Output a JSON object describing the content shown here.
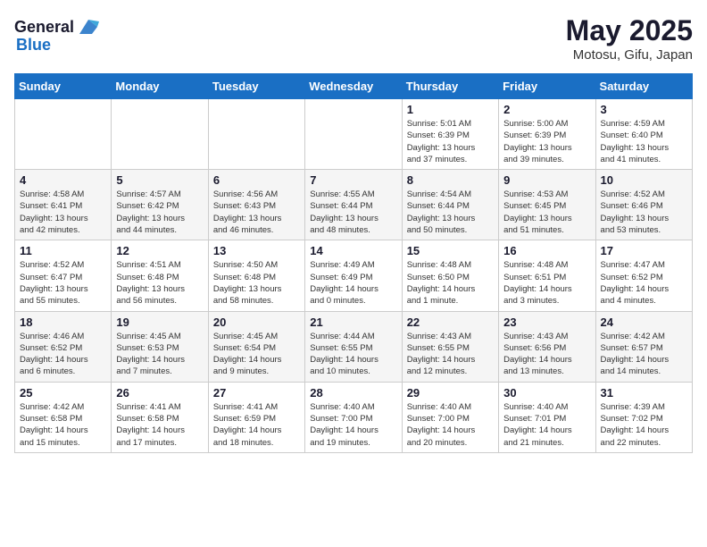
{
  "header": {
    "logo_general": "General",
    "logo_blue": "Blue",
    "month_year": "May 2025",
    "location": "Motosu, Gifu, Japan"
  },
  "weekdays": [
    "Sunday",
    "Monday",
    "Tuesday",
    "Wednesday",
    "Thursday",
    "Friday",
    "Saturday"
  ],
  "weeks": [
    [
      {
        "day": "",
        "info": ""
      },
      {
        "day": "",
        "info": ""
      },
      {
        "day": "",
        "info": ""
      },
      {
        "day": "",
        "info": ""
      },
      {
        "day": "1",
        "info": "Sunrise: 5:01 AM\nSunset: 6:39 PM\nDaylight: 13 hours\nand 37 minutes."
      },
      {
        "day": "2",
        "info": "Sunrise: 5:00 AM\nSunset: 6:39 PM\nDaylight: 13 hours\nand 39 minutes."
      },
      {
        "day": "3",
        "info": "Sunrise: 4:59 AM\nSunset: 6:40 PM\nDaylight: 13 hours\nand 41 minutes."
      }
    ],
    [
      {
        "day": "4",
        "info": "Sunrise: 4:58 AM\nSunset: 6:41 PM\nDaylight: 13 hours\nand 42 minutes."
      },
      {
        "day": "5",
        "info": "Sunrise: 4:57 AM\nSunset: 6:42 PM\nDaylight: 13 hours\nand 44 minutes."
      },
      {
        "day": "6",
        "info": "Sunrise: 4:56 AM\nSunset: 6:43 PM\nDaylight: 13 hours\nand 46 minutes."
      },
      {
        "day": "7",
        "info": "Sunrise: 4:55 AM\nSunset: 6:44 PM\nDaylight: 13 hours\nand 48 minutes."
      },
      {
        "day": "8",
        "info": "Sunrise: 4:54 AM\nSunset: 6:44 PM\nDaylight: 13 hours\nand 50 minutes."
      },
      {
        "day": "9",
        "info": "Sunrise: 4:53 AM\nSunset: 6:45 PM\nDaylight: 13 hours\nand 51 minutes."
      },
      {
        "day": "10",
        "info": "Sunrise: 4:52 AM\nSunset: 6:46 PM\nDaylight: 13 hours\nand 53 minutes."
      }
    ],
    [
      {
        "day": "11",
        "info": "Sunrise: 4:52 AM\nSunset: 6:47 PM\nDaylight: 13 hours\nand 55 minutes."
      },
      {
        "day": "12",
        "info": "Sunrise: 4:51 AM\nSunset: 6:48 PM\nDaylight: 13 hours\nand 56 minutes."
      },
      {
        "day": "13",
        "info": "Sunrise: 4:50 AM\nSunset: 6:48 PM\nDaylight: 13 hours\nand 58 minutes."
      },
      {
        "day": "14",
        "info": "Sunrise: 4:49 AM\nSunset: 6:49 PM\nDaylight: 14 hours\nand 0 minutes."
      },
      {
        "day": "15",
        "info": "Sunrise: 4:48 AM\nSunset: 6:50 PM\nDaylight: 14 hours\nand 1 minute."
      },
      {
        "day": "16",
        "info": "Sunrise: 4:48 AM\nSunset: 6:51 PM\nDaylight: 14 hours\nand 3 minutes."
      },
      {
        "day": "17",
        "info": "Sunrise: 4:47 AM\nSunset: 6:52 PM\nDaylight: 14 hours\nand 4 minutes."
      }
    ],
    [
      {
        "day": "18",
        "info": "Sunrise: 4:46 AM\nSunset: 6:52 PM\nDaylight: 14 hours\nand 6 minutes."
      },
      {
        "day": "19",
        "info": "Sunrise: 4:45 AM\nSunset: 6:53 PM\nDaylight: 14 hours\nand 7 minutes."
      },
      {
        "day": "20",
        "info": "Sunrise: 4:45 AM\nSunset: 6:54 PM\nDaylight: 14 hours\nand 9 minutes."
      },
      {
        "day": "21",
        "info": "Sunrise: 4:44 AM\nSunset: 6:55 PM\nDaylight: 14 hours\nand 10 minutes."
      },
      {
        "day": "22",
        "info": "Sunrise: 4:43 AM\nSunset: 6:55 PM\nDaylight: 14 hours\nand 12 minutes."
      },
      {
        "day": "23",
        "info": "Sunrise: 4:43 AM\nSunset: 6:56 PM\nDaylight: 14 hours\nand 13 minutes."
      },
      {
        "day": "24",
        "info": "Sunrise: 4:42 AM\nSunset: 6:57 PM\nDaylight: 14 hours\nand 14 minutes."
      }
    ],
    [
      {
        "day": "25",
        "info": "Sunrise: 4:42 AM\nSunset: 6:58 PM\nDaylight: 14 hours\nand 15 minutes."
      },
      {
        "day": "26",
        "info": "Sunrise: 4:41 AM\nSunset: 6:58 PM\nDaylight: 14 hours\nand 17 minutes."
      },
      {
        "day": "27",
        "info": "Sunrise: 4:41 AM\nSunset: 6:59 PM\nDaylight: 14 hours\nand 18 minutes."
      },
      {
        "day": "28",
        "info": "Sunrise: 4:40 AM\nSunset: 7:00 PM\nDaylight: 14 hours\nand 19 minutes."
      },
      {
        "day": "29",
        "info": "Sunrise: 4:40 AM\nSunset: 7:00 PM\nDaylight: 14 hours\nand 20 minutes."
      },
      {
        "day": "30",
        "info": "Sunrise: 4:40 AM\nSunset: 7:01 PM\nDaylight: 14 hours\nand 21 minutes."
      },
      {
        "day": "31",
        "info": "Sunrise: 4:39 AM\nSunset: 7:02 PM\nDaylight: 14 hours\nand 22 minutes."
      }
    ]
  ]
}
